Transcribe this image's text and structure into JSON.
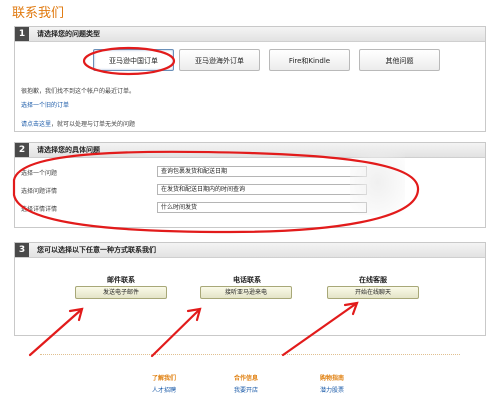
{
  "page": {
    "title": "联系我们"
  },
  "section1": {
    "number": "1",
    "title": "请选择您的问题类型",
    "tabs": [
      "亚马逊中国订单",
      "亚马逊海外订单",
      "Fire和Kindle",
      "其他问题"
    ],
    "selected_tab": "亚马逊中国订单",
    "notice": "很抱歉，我们找不到这个帐户的最近订单。",
    "link_old_order": "选择一个旧的订单",
    "link_here": "请点击这里",
    "here_suffix": "，就可以处理与订单无关的问题"
  },
  "section2": {
    "number": "2",
    "title": "请选择您的具体问题",
    "rows": [
      {
        "label": "选择一个问题",
        "value": "查询包裹发货和配送日期"
      },
      {
        "label": "选择问题详情",
        "value": "在发货和配送日期内的时间查询"
      },
      {
        "label": "选择详情详情",
        "value": "什么时间发货"
      }
    ]
  },
  "section3": {
    "number": "3",
    "title": "您可以选择以下任意一种方式联系我们",
    "methods": [
      {
        "heading": "邮件联系",
        "button": "发送电子邮件"
      },
      {
        "heading": "电话联系",
        "button": "接听亚马逊来电"
      },
      {
        "heading": "在线客服",
        "button": "开始在线聊天"
      }
    ]
  },
  "footer": {
    "cols": [
      {
        "heading": "了解我们",
        "link": "人才招聘"
      },
      {
        "heading": "合作信息",
        "link": "我要开店"
      },
      {
        "heading": "购物指南",
        "link": "潜力股票"
      }
    ]
  },
  "colors": {
    "accent": "#e07a10",
    "annotation": "#e21b1b",
    "link": "#1a5aa8"
  }
}
